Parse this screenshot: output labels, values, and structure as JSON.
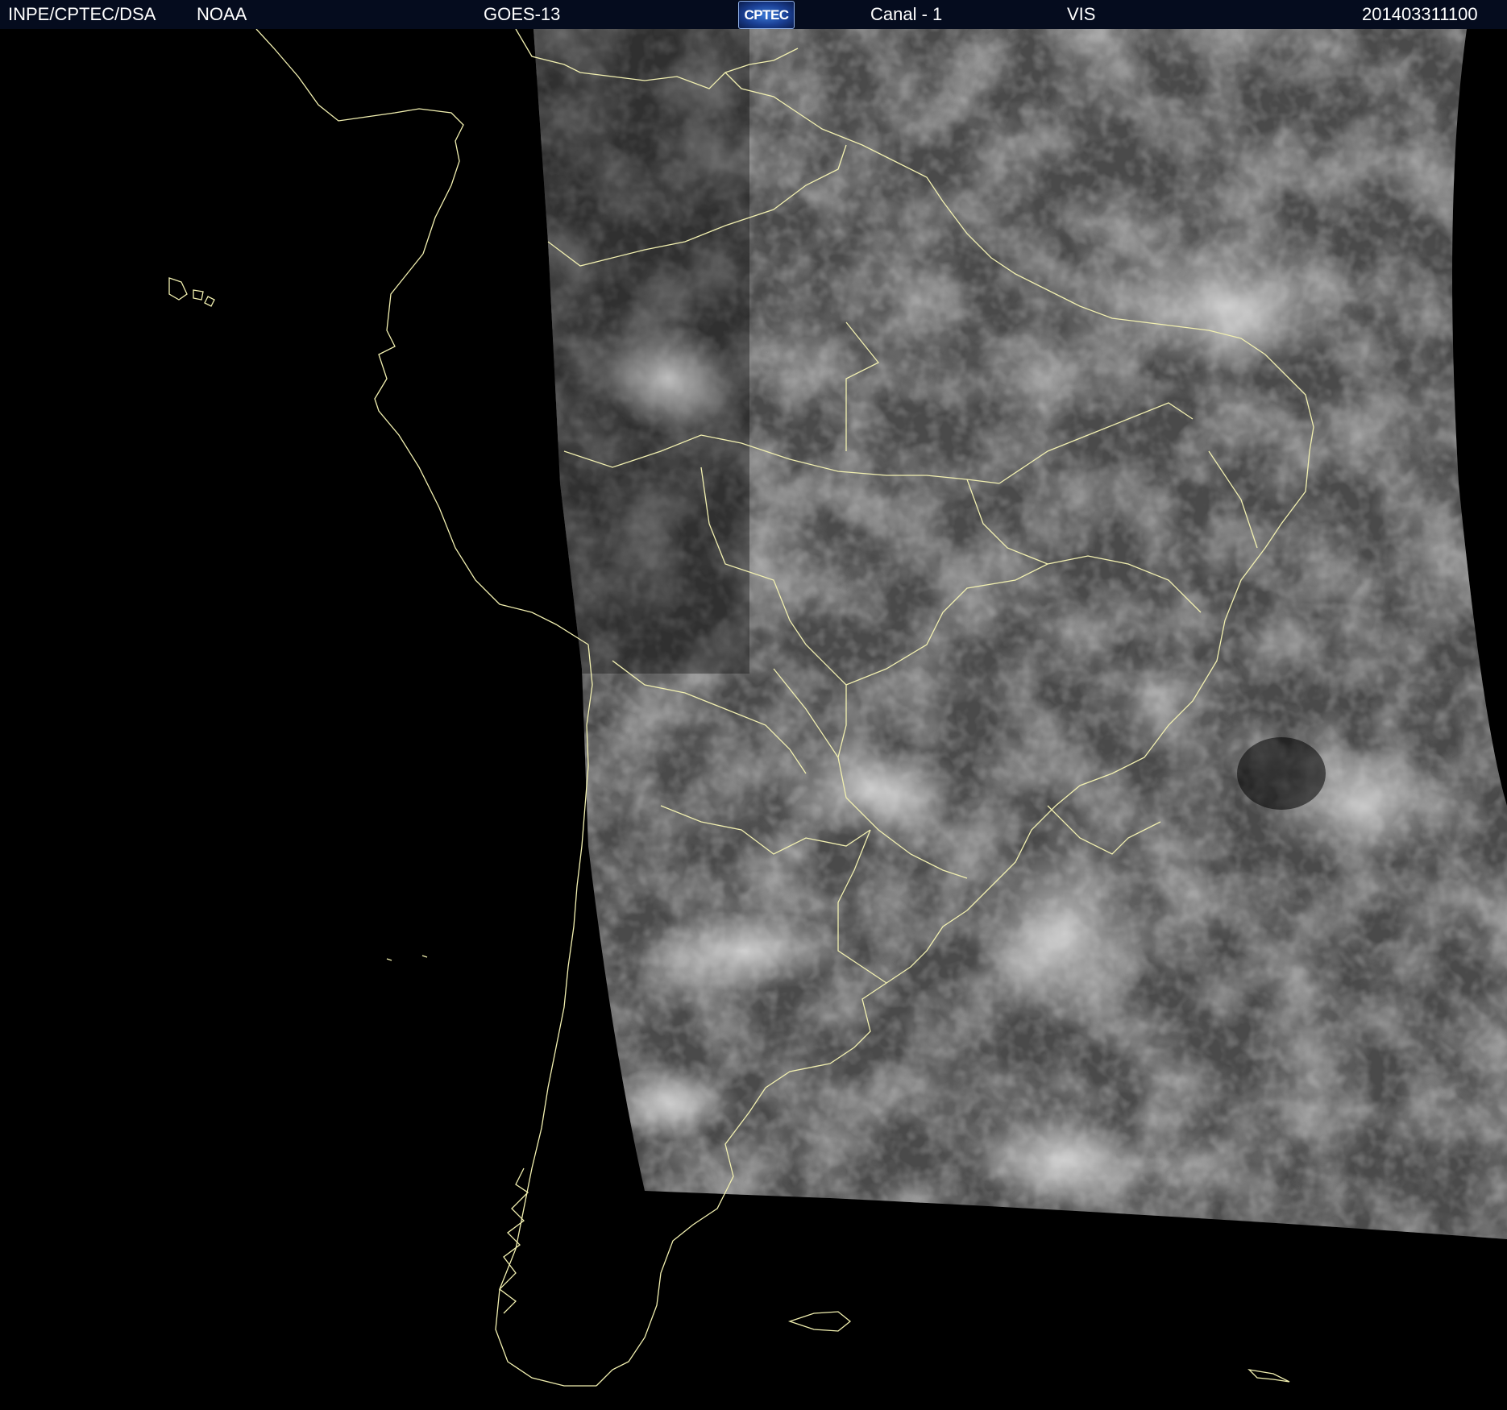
{
  "header": {
    "agency": "INPE/CPTEC/DSA",
    "partner": "NOAA",
    "satellite": "GOES-13",
    "logo_text": "CPTEC",
    "channel": "Canal - 1",
    "band": "VIS",
    "timestamp": "201403311100"
  },
  "colors": {
    "background": "#000000",
    "header_background": "#050c1e",
    "header_text": "#ffffff",
    "coastline": "#f2f0b0"
  },
  "imagery": {
    "description_kind": "visible-channel satellite image"
  }
}
